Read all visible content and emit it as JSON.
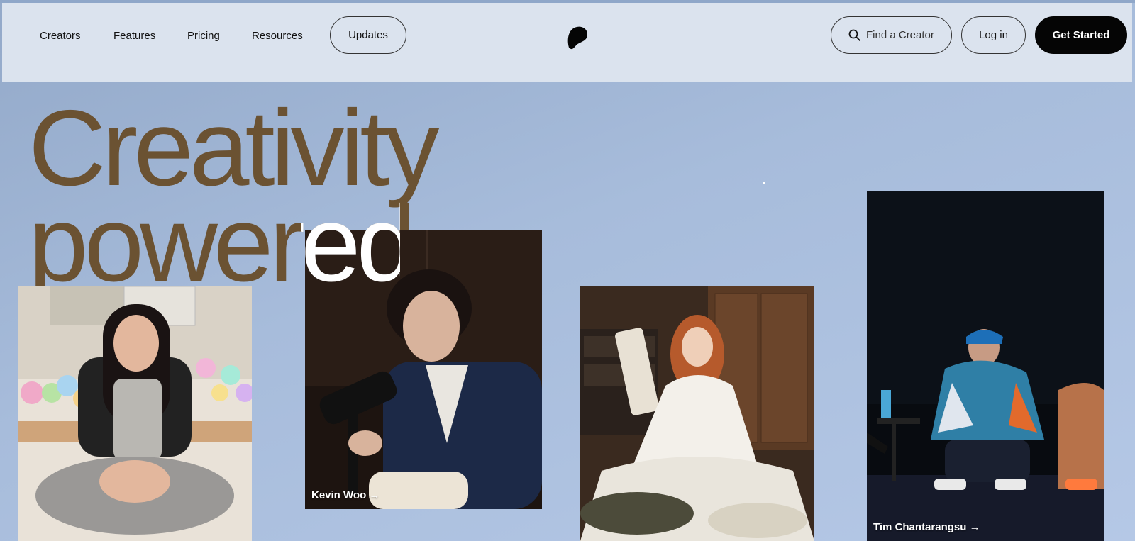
{
  "nav": {
    "links": [
      "Creators",
      "Features",
      "Pricing",
      "Resources"
    ],
    "updates_label": "Updates",
    "search_label": "Find a Creator",
    "login_label": "Log in",
    "get_started_label": "Get Started",
    "logo_icon": "patreon-logo-icon"
  },
  "hero": {
    "line1": "Creativity",
    "line2": "powered"
  },
  "cards": [
    {
      "caption": ""
    },
    {
      "caption": "Kevin Woo →"
    },
    {
      "caption": ""
    },
    {
      "caption": "Tim Chantarangsu →"
    }
  ],
  "colors": {
    "background": "#a7bcdb",
    "header": "#dbe3ee",
    "hero_text": "#6b5232",
    "button_dark": "#050505"
  }
}
